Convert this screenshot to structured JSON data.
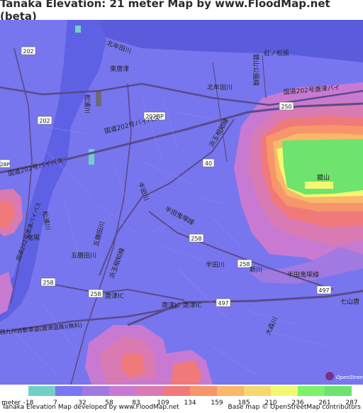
{
  "title": "Tanaka Elevation: 21 meter Map by www.FloodMap.net (beta)",
  "legend": {
    "unit": "meter",
    "ticks": [
      "-18",
      "7",
      "32",
      "58",
      "83",
      "109",
      "134",
      "159",
      "185",
      "210",
      "236",
      "261",
      "287"
    ],
    "colors": [
      "#6fd1c5",
      "#7a78f0",
      "#a07ae0",
      "#c87ad2",
      "#d97ab2",
      "#f07a7a",
      "#f7966a",
      "#f9b86a",
      "#f5d96e",
      "#f4f870",
      "#7cf26a",
      "#6ee36e"
    ]
  },
  "footer": {
    "left": "Tanaka Elevation Map developed by www.FloodMap.net",
    "right": "Base map © OpenStreetMap contributors"
  },
  "map": {
    "watermark": "OpenStreetMap",
    "labels": {
      "road_202": "202",
      "road_202b": "202",
      "road_202bp": "202BP",
      "road_202_bp_left": "2BP",
      "road_40": "40",
      "road_250": "250",
      "road_258a": "258",
      "road_258b": "258",
      "road_258c": "258",
      "road_258d": "258",
      "road_497a": "497",
      "road_497b": "497",
      "higashi_karatsu": "東唐津",
      "karatsu_ic": "唐津IC",
      "karatsu_ic2": "唐津IC 唐津IC",
      "national_road": "国道202号唐津バイパス",
      "national_road2": "国道202号バイパス",
      "national_road3": "国道202号唐津バイ",
      "kitamuta": "北牟田川",
      "kitamuta2": "北牟田川",
      "gomuta": "五膳田川",
      "hanada": "半田川",
      "shinkawa": "新川",
      "handa_line": "半田鬼塚線",
      "handa_line2": "半田鬼塚線",
      "hamatama": "浜玉相知線",
      "hamatama2": "浜玉相知線",
      "matsuura": "松浦川",
      "matsuura2": "松浦川",
      "kagamiyama": "鏡山",
      "kagamiyama_line": "鏡山公園線",
      "niji": "虹ノ松原",
      "oni": "鬼塚",
      "nishikyushu": "西九州自動車道(唐津道路)(無料)",
      "nanayama": "七山唐",
      "oomori": "大森川"
    }
  }
}
